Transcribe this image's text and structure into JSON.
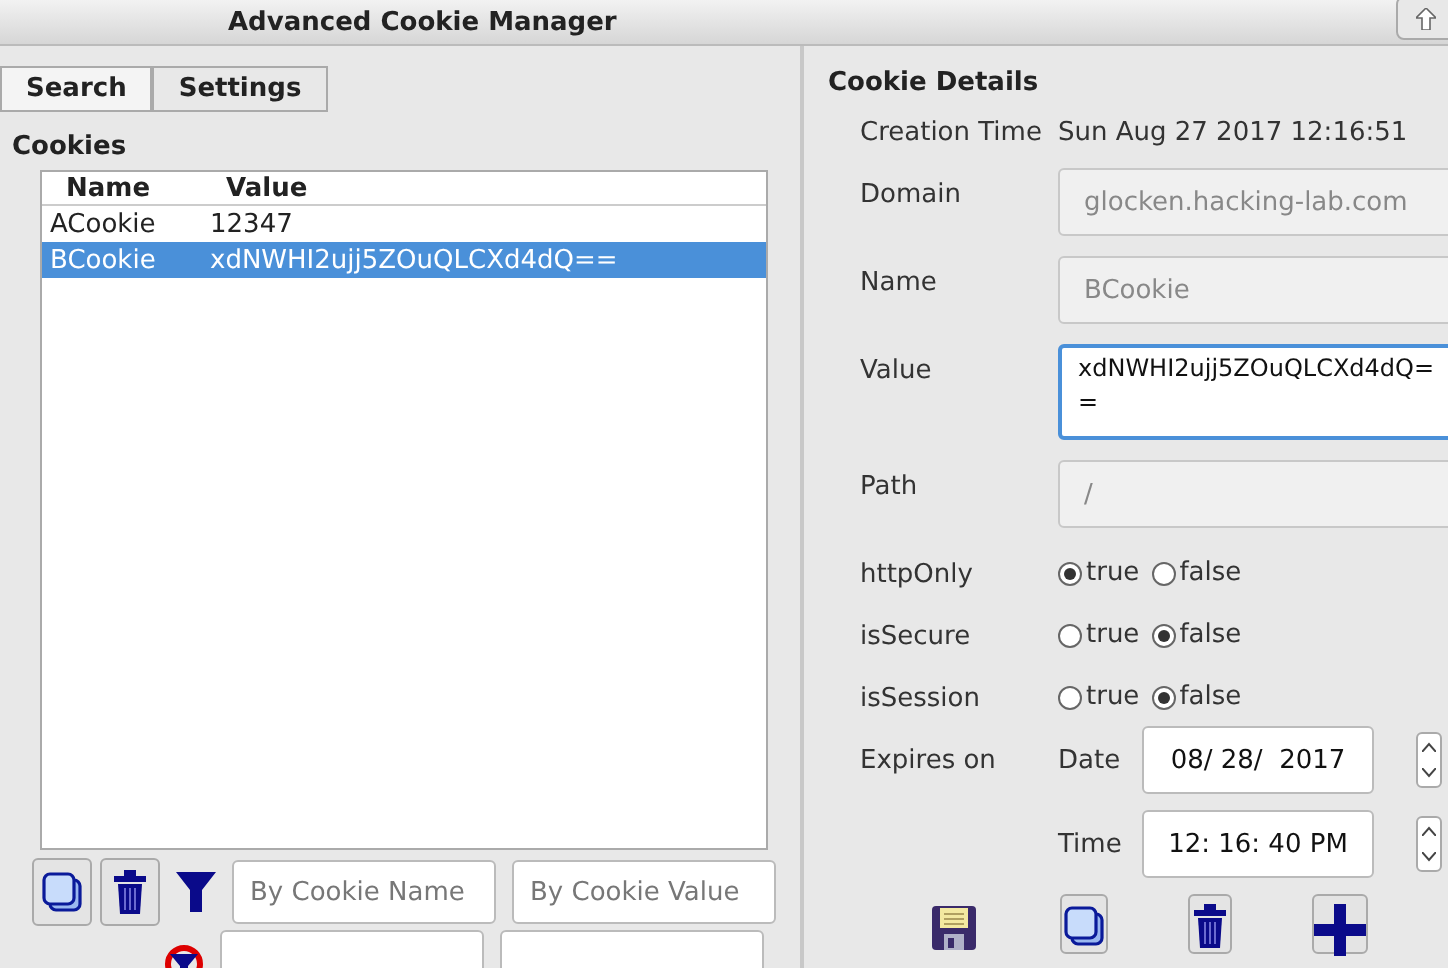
{
  "window": {
    "title": "Advanced Cookie Manager"
  },
  "tabs": [
    {
      "label": "Search",
      "selected": true
    },
    {
      "label": "Settings",
      "selected": false
    }
  ],
  "cookies": {
    "heading": "Cookies",
    "columns": [
      "Name",
      "Value"
    ],
    "rows": [
      {
        "name": "ACookie",
        "value": "12347",
        "selected": false
      },
      {
        "name": "BCookie",
        "value": "xdNWHI2ujj5ZOuQLCXd4dQ==",
        "selected": true
      }
    ]
  },
  "filters": [
    {
      "placeholder": "By Cookie Name"
    },
    {
      "placeholder": "By Cookie Value"
    }
  ],
  "details": {
    "heading": "Cookie Details",
    "creation": {
      "label": "Creation Time",
      "value": "Sun Aug 27 2017 12:16:51"
    },
    "fields": [
      {
        "label": "Domain",
        "value": "glocken.hacking-lab.com",
        "kind": "text",
        "disabled": true
      },
      {
        "label": "Name",
        "value": "BCookie",
        "kind": "text",
        "disabled": true
      },
      {
        "label": "Value",
        "value": "xdNWHI2ujj5ZOuQLCXd4dQ=\n=",
        "kind": "area",
        "disabled": false
      },
      {
        "label": "Path",
        "value": "/",
        "kind": "text",
        "disabled": true
      }
    ],
    "flags": [
      {
        "label": "httpOnly",
        "options": [
          {
            "label": "true",
            "selected": true
          },
          {
            "label": "false",
            "selected": false
          }
        ]
      },
      {
        "label": "isSecure",
        "options": [
          {
            "label": "true",
            "selected": false
          },
          {
            "label": "false",
            "selected": true
          }
        ]
      },
      {
        "label": "isSession",
        "options": [
          {
            "label": "true",
            "selected": false
          },
          {
            "label": "false",
            "selected": true
          }
        ]
      }
    ],
    "expires": {
      "label": "Expires on",
      "date": {
        "label": "Date",
        "value": "08/ 28/  2017"
      },
      "time": {
        "label": "Time",
        "value": "12: 16: 40 PM"
      }
    }
  }
}
